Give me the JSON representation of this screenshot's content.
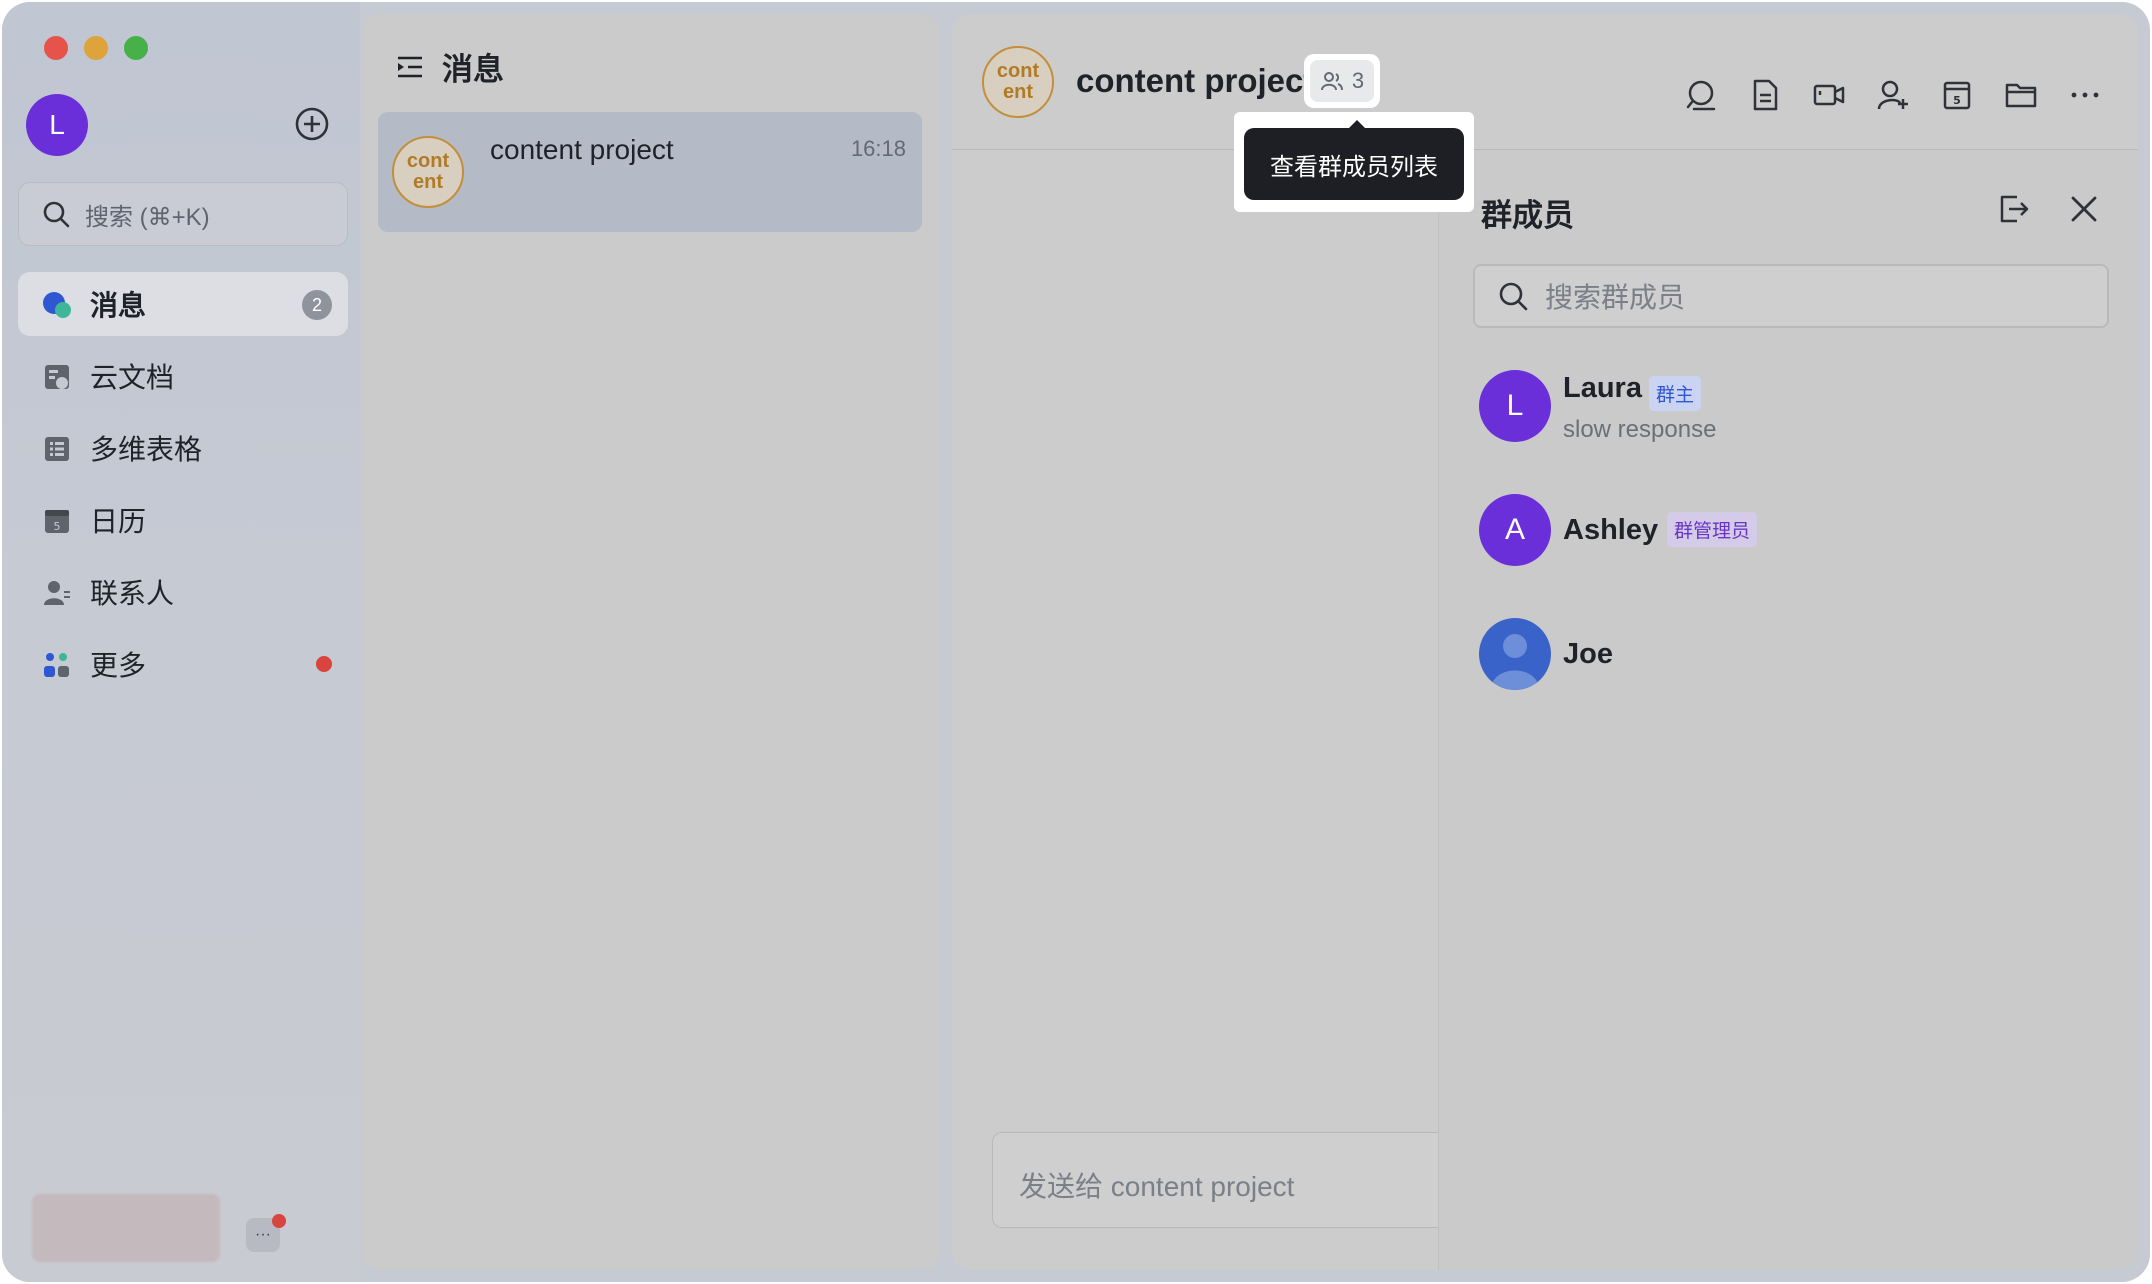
{
  "sidebar": {
    "user_initial": "L",
    "search_placeholder": "搜索 (⌘+K)",
    "items": [
      {
        "label": "消息",
        "badge": "2"
      },
      {
        "label": "云文档"
      },
      {
        "label": "多维表格"
      },
      {
        "label": "日历",
        "icon_text": "5"
      },
      {
        "label": "联系人"
      },
      {
        "label": "更多"
      }
    ],
    "more_glyph": "···"
  },
  "list": {
    "title": "消息",
    "conversations": [
      {
        "avatar_text": "cont\nent",
        "name": "content project",
        "time": "16:18"
      }
    ]
  },
  "chat": {
    "avatar_text": "cont\nent",
    "title": "content project",
    "member_count": "3",
    "input_placeholder": "发送给 content project",
    "tooltip": "查看群成员列表"
  },
  "members_panel": {
    "title": "群成员",
    "search_placeholder": "搜索群成员",
    "members": [
      {
        "initial": "L",
        "name": "Laura",
        "role": "群主",
        "status": "slow response"
      },
      {
        "initial": "A",
        "name": "Ashley",
        "role": "群管理员"
      },
      {
        "initial": "",
        "name": "Joe"
      }
    ]
  },
  "colors": {
    "accent": "#6a2fd8",
    "owner_tag_bg": "#cbd3f3",
    "owner_tag_fg": "#2f57d1",
    "admin_tag_bg": "#d3cbe7",
    "admin_tag_fg": "#6a35c4",
    "unread_dot": "#d9453e"
  }
}
